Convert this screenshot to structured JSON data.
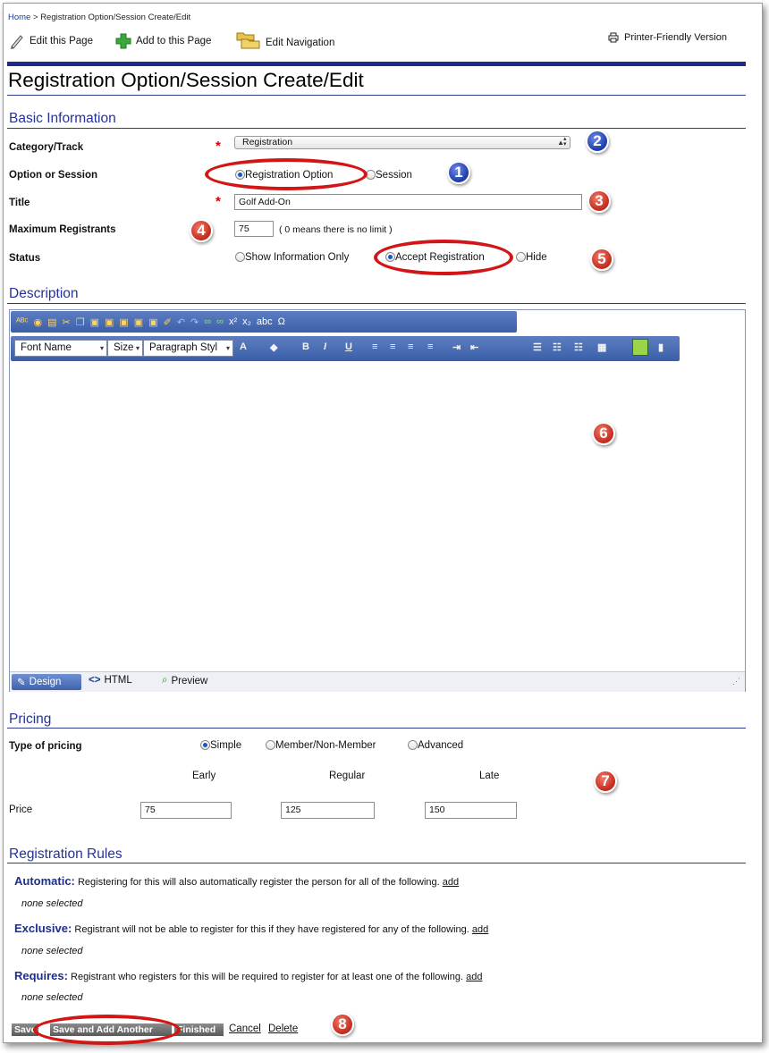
{
  "breadcrumb": {
    "home": "Home",
    "separator": ">",
    "current": "Registration Option/Session Create/Edit"
  },
  "toolbar": {
    "edit_page": "Edit this Page",
    "add_page": "Add to this Page",
    "edit_nav": "Edit Navigation",
    "printer": "Printer-Friendly Version"
  },
  "page_title": "Registration Option/Session Create/Edit",
  "basic": {
    "heading": "Basic Information",
    "category_label": "Category/Track",
    "category_value": "Registration",
    "option_label": "Option or Session",
    "option_registration": "Registration Option",
    "option_session": "Session",
    "title_label": "Title",
    "title_value": "Golf Add-On",
    "max_label": "Maximum Registrants",
    "max_value": "75",
    "max_hint": "( 0 means there is no limit )",
    "status_label": "Status",
    "status_info": "Show Information Only",
    "status_accept": "Accept Registration",
    "status_hide": "Hide",
    "required_mark": "*"
  },
  "description": {
    "heading": "Description",
    "font_name": "Font Name",
    "size": "Size",
    "paragraph": "Paragraph Styl",
    "tab_design": "Design",
    "tab_html": "HTML",
    "tab_preview": "Preview"
  },
  "pricing": {
    "heading": "Pricing",
    "type_label": "Type of pricing",
    "type_simple": "Simple",
    "type_member": "Member/Non-Member",
    "type_advanced": "Advanced",
    "col_early": "Early",
    "col_regular": "Regular",
    "col_late": "Late",
    "price_label": "Price",
    "early_value": "75",
    "regular_value": "125",
    "late_value": "150"
  },
  "rules": {
    "heading": "Registration Rules",
    "automatic_title": "Automatic:",
    "automatic_text": "Registering for this will also automatically register the person for all of the following.",
    "exclusive_title": "Exclusive:",
    "exclusive_text": "Registrant will not be able to register for this if they have registered for any of the following.",
    "requires_title": "Requires:",
    "requires_text": "Registrant who registers for this will be required to register for at least one of the following.",
    "add": "add",
    "none": "none selected"
  },
  "actions": {
    "save": "Save",
    "save_another": "Save and Add Another",
    "finished": "Finished",
    "cancel": "Cancel",
    "delete": "Delete"
  },
  "badges": {
    "b1": "1",
    "b2": "2",
    "b3": "3",
    "b4": "4",
    "b5": "5",
    "b6": "6",
    "b7": "7",
    "b8": "8"
  },
  "colors": {
    "heading": "#24329a",
    "rule": "#2d3c8f",
    "annotation_red": "#d21616",
    "required": "#d20000"
  }
}
